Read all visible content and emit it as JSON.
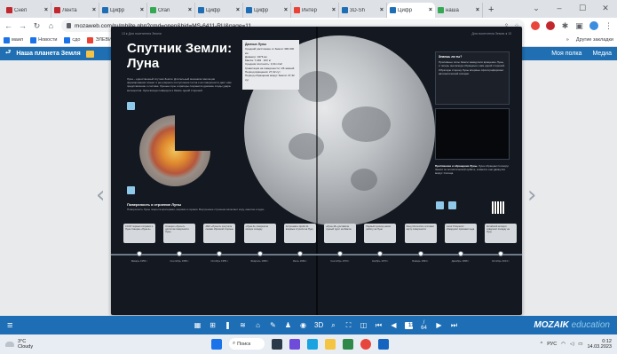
{
  "browser": {
    "tabs": [
      {
        "label": "Снеп",
        "color": "#c1272d"
      },
      {
        "label": "Лента",
        "color": "#c1272d"
      },
      {
        "label": "Цифр",
        "color": "#1e6eb5"
      },
      {
        "label": "Oran",
        "color": "#34a853"
      },
      {
        "label": "Цифр",
        "color": "#1e6eb5"
      },
      {
        "label": "Цифр",
        "color": "#1e6eb5"
      },
      {
        "label": "Интер",
        "color": "#ea4335"
      },
      {
        "label": "3D-Sh",
        "color": "#1e6eb5"
      },
      {
        "label": "Цифр",
        "color": "#1e6eb5"
      },
      {
        "label": "наша",
        "color": "#34a853"
      }
    ],
    "active_tab_index": 8,
    "url": "mozaweb.com/ru/mblite.php?cmd=open&bid=MS-6411-RU&page=11",
    "bookmarks": [
      {
        "label": "маил",
        "color": "#1a73e8"
      },
      {
        "label": "Новости",
        "color": "#1a73e8"
      },
      {
        "label": "сдо",
        "color": "#1a73e8"
      },
      {
        "label": "ЭЛЕВИМРИ",
        "color": "#ea4335"
      },
      {
        "label": "Приложение КоМ...",
        "color": "#1e6eb5"
      },
      {
        "label": "Innovationyie_mat...",
        "color": "#1e6eb5"
      },
      {
        "label": "Сравнительный ан...",
        "color": "#555555"
      },
      {
        "label": "Тоговое решени...",
        "color": "#1a73e8"
      },
      {
        "label": "215 стра",
        "color": "#e37400"
      }
    ],
    "bookmarks_other": "Другие закладки"
  },
  "app": {
    "title": "Наша планета Земля",
    "my_shelf": "Моя полка",
    "media": "Медиа"
  },
  "book": {
    "left_header": "13  ♦  Для посетителя Земли",
    "right_header": "Для посетителя Земли  ♦  13",
    "title": "Спутник Земли: Луна",
    "intro": "Луна – единственный спутник Земли. Длительный механизм эволюции формирования планет и регулярного поступления тепла к её поверхности даёт нам представление о составе. Лунные горы и кратеры сохранили древние следы удара метеоритов. Луна всегда повёрнута к Земле одной стороной.",
    "infobox": {
      "title": "Данные Луны",
      "lines": [
        "Средний расстояние от Земли: 384 000 км",
        "Диаметр: 3476 км",
        "Масса: 7,349 · 10²² кг",
        "Средняя плотность: 3,34 г/см³",
        "Гравитация на поверхности: 1/6 земной",
        "Период вращения: 27,32 сут",
        "Период обращения вокруг Земли: 27,32 сут"
      ]
    },
    "callout": {
      "title": "Знаешь ли ты?",
      "text": "Приливные силы Земли замедлили вращение Луны, и теперь она всегда обращена к нам одной стороной. Обратную сторону Луны впервые сфотографировал автоматический аппарат."
    },
    "side_caption": {
      "title": "Притяжение и обращение Луны.",
      "text": "Луна обращается вокруг Земли по эллиптической орбите, а вместе они движутся вокруг Солнца."
    },
    "section_heading": "Поверхность и строение Луны",
    "section_sub": "Поверхность Луны покрыта кратерами, морями и горами. Внутреннее строение включает кору, мантию и ядро.",
    "timeline": [
      {
        "date": "Январь 1959 г.",
        "text": "СССР первым отправил к Луне станцию «Луна-1»"
      },
      {
        "date": "Сентябрь 1959 г.",
        "text": "Станция «Луна-2» достигла поверхности Луны"
      },
      {
        "date": "Октябрь 1959 г.",
        "text": "АМС «Луна-3» получила снимки обратной стороны"
      },
      {
        "date": "Февраль 1966 г.",
        "text": "«Луна-9» совершила мягкую посадку"
      },
      {
        "date": "Июль 1969 г.",
        "text": "Астронавты Apollo 11 впервые ступили на Луну"
      },
      {
        "date": "Сентябрь 1970 г.",
        "text": "«Луна-16» доставила лунный грунт на Землю"
      },
      {
        "date": "Ноябрь 1970 г.",
        "text": "Первый луноход начал работу на Луне"
      },
      {
        "date": "Январь 1994 г.",
        "text": "Зонд Clementine составил карту поверхности"
      },
      {
        "date": "Декабрь 1998 г.",
        "text": "Lunar Prospector обнаружил признаки льда"
      },
      {
        "date": "Октябрь 2013 г.",
        "text": "Китайский аппарат совершил посадку на Луну"
      }
    ]
  },
  "pagebar": {
    "current_page": "11",
    "total_pages": "/ 64",
    "brand_bold": "MOZAIK",
    "brand_light": "education",
    "color": "#1e6eb5"
  },
  "taskbar": {
    "weather_temp": "3°C",
    "weather_desc": "Cloudy",
    "search_label": "Поиск",
    "lang": "РУС",
    "time": "0:12",
    "date": "14.03.2023"
  }
}
